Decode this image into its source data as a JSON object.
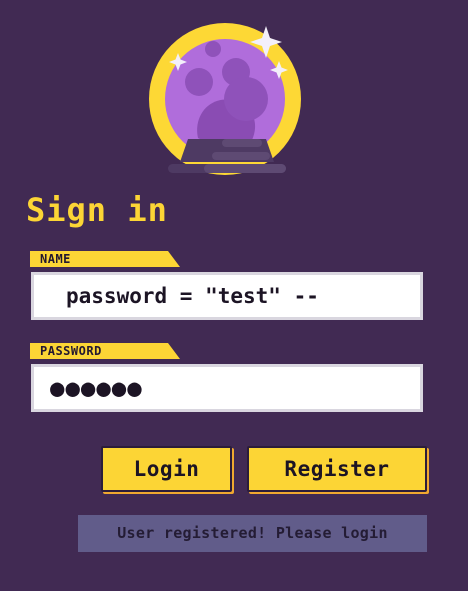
{
  "logo": {
    "icon": "crystal-ball-icon",
    "colors": {
      "ring": "#fdd835",
      "ball": "#ab67d8",
      "ball_shade": "#8a4cb3",
      "stand": "#4e3a63",
      "sparkle": "#f3effa"
    }
  },
  "heading": "Sign in",
  "form": {
    "name_label": "NAME",
    "name_value": "password = \"test\" --",
    "password_label": "PASSWORD",
    "password_value": "●●●●●●"
  },
  "buttons": {
    "login": "Login",
    "register": "Register"
  },
  "status": {
    "message": "User registered! Please login"
  },
  "colors": {
    "background": "#412a53",
    "accent": "#fcd535",
    "notice_bg": "#615c8a"
  }
}
